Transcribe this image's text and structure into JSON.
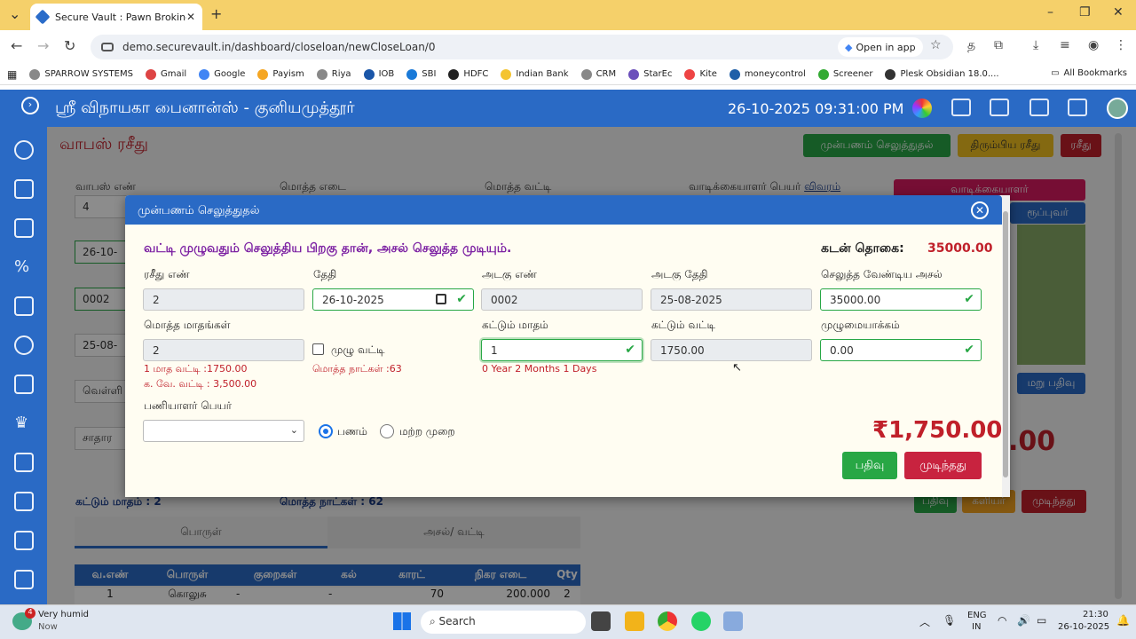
{
  "browser": {
    "tab_title": "Secure Vault : Pawn Broking Exp",
    "url": "demo.securevault.in/dashboard/closeloan/newCloseLoan/0",
    "open_in_app": "Open in app",
    "bookmarks": [
      "SPARROW SYSTEMS",
      "Gmail",
      "Google",
      "Payism",
      "Riya",
      "IOB",
      "SBI",
      "HDFC",
      "Indian Bank",
      "CRM",
      "StarEc",
      "Kite",
      "moneycontrol",
      "Screener",
      "Plesk Obsidian 18.0...."
    ],
    "all_bookmarks": "All Bookmarks"
  },
  "app": {
    "title": "ஸ்ரீ விநாயகா பைனான்ஸ் - குனியமுத்தூர்",
    "datetime": "26-10-2025 09:31:00 PM",
    "heading": "வாபஸ் ரசீது",
    "top_buttons": [
      "முன்பணம் செலுத்துதல்",
      "திரும்பிய ரசீது",
      "ரசீது"
    ]
  },
  "background": {
    "labels": {
      "vapas_en": "வாபஸ் எண்",
      "motha_edai": "மொத்த எடை",
      "motha_vatti": "மொத்த வட்டி",
      "customer_name": "வாடிக்கையாளர் பெயர்",
      "details_link": "விவரம்"
    },
    "values": {
      "vapas_en": "4",
      "date": "26-10-",
      "receipt": "0002",
      "receipt_date": "25-08-",
      "item": "வெள்ளி",
      "type": "சாதார"
    },
    "side_buttons": [
      "வாடிக்கையாளர்",
      "ரூப்புவர்",
      "மறு பதிவு"
    ],
    "kattum_matham": "கட்டும் மாதம் : 2",
    "motha_natkal": "மொத்த நாட்கள் : 62",
    "tabs": [
      "பொருள்",
      "அசல்/ வட்டி"
    ],
    "table_headers": [
      "வ.எண்",
      "பொருள்",
      "குறைகள்",
      "கல்",
      "காரட்",
      "நிகர எடை",
      "Qty"
    ],
    "table_row": [
      "1",
      "கொலுசு",
      "-",
      "-",
      "70",
      "200.000",
      "2"
    ],
    "bottom_buttons": [
      "பதிவு",
      "களியர்",
      "முடிந்தது"
    ],
    "amount_partial": ".00"
  },
  "modal": {
    "title": "முன்பணம் செலுத்துதல்",
    "notice": "வட்டி முழுவதும் செலுத்திய பிறகு தான், அசல் செலுத்த முடியும்.",
    "loan_label": "கடன் தொகை:",
    "loan_value": "35000.00",
    "fields": {
      "receipt_no": {
        "label": "ரசீது எண்",
        "value": "2"
      },
      "date": {
        "label": "தேதி",
        "value": "26-10-2025"
      },
      "pledge_no": {
        "label": "அடகு எண்",
        "value": "0002"
      },
      "pledge_date": {
        "label": "அடகு தேதி",
        "value": "25-08-2025"
      },
      "principal_due": {
        "label": "செலுத்த வேண்டிய அசல்",
        "value": "35000.00"
      },
      "total_months": {
        "label": "மொத்த மாதங்கள்",
        "value": "2"
      },
      "paying_month": {
        "label": "கட்டும் மாதம்",
        "value": "1"
      },
      "paying_interest": {
        "label": "கட்டும் வட்டி",
        "value": "1750.00"
      },
      "rounding": {
        "label": "முழுமையாக்கம்",
        "value": "0.00"
      }
    },
    "full_interest": "முழு வட்டி",
    "monthly_interest": "1 மாத வட்டி :1750.00",
    "past_interest": "க. வே. வட்டி : 3,500.00",
    "total_days": "மொத்த நாட்கள் :63",
    "duration": "0 Year 2 Months 1 Days",
    "staff_label": "பணியாளர் பெயர்",
    "pay_cash": "பணம்",
    "pay_other": "மற்ற முறை",
    "amount": "₹1,750.00",
    "save_btn": "பதிவு",
    "done_btn": "முடிந்தது"
  },
  "taskbar": {
    "weather": "Very humid",
    "weather_sub": "Now",
    "badge": "4",
    "search": "Search",
    "lang": "ENG",
    "lang2": "IN",
    "time": "21:30",
    "date": "26-10-2025"
  },
  "colors": {
    "primary": "#2a6ac5",
    "danger": "#c0202a",
    "success": "#28a745",
    "notice": "#7b1fa2"
  }
}
